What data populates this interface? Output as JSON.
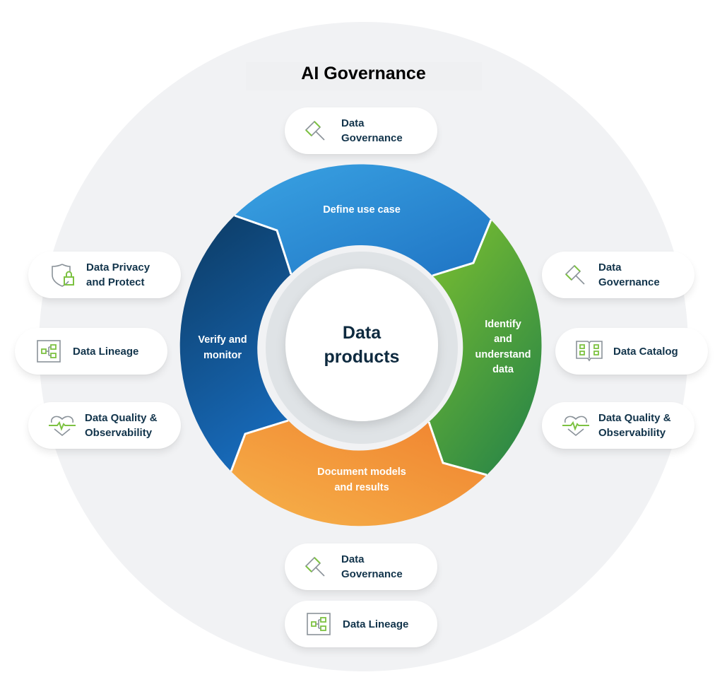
{
  "title": "AI Governance",
  "center": {
    "line1": "Data",
    "line2": "products"
  },
  "segments": [
    {
      "id": "define",
      "lines": [
        "Define use case"
      ],
      "color_start": "#3aa3e3",
      "color_end": "#1f74c4"
    },
    {
      "id": "identify",
      "lines": [
        "Identify",
        "and",
        "understand",
        "data"
      ],
      "color_start": "#7dc02f",
      "color_end": "#2f8a45"
    },
    {
      "id": "document",
      "lines": [
        "Document models",
        "and results"
      ],
      "color_start": "#f6b24a",
      "color_end": "#f0822f"
    },
    {
      "id": "verify",
      "lines": [
        "Verify and",
        "monitor"
      ],
      "color_start": "#0c3a62",
      "color_end": "#1768b6"
    }
  ],
  "cards": {
    "top_governance": {
      "label": "Data\nGovernance",
      "icon": "gavel-icon"
    },
    "left_privacy": {
      "label": "Data Privacy\nand Protect",
      "icon": "shield-lock-icon"
    },
    "left_lineage": {
      "label": "Data Lineage",
      "icon": "lineage-icon"
    },
    "left_quality": {
      "label": "Data Quality &\nObservability",
      "icon": "heart-pulse-icon"
    },
    "right_governance": {
      "label": "Data\nGovernance",
      "icon": "gavel-icon"
    },
    "right_catalog": {
      "label": "Data Catalog",
      "icon": "book-icon"
    },
    "right_quality": {
      "label": "Data Quality &\nObservability",
      "icon": "heart-pulse-icon"
    },
    "bottom_governance": {
      "label": "Data\nGovernance",
      "icon": "gavel-icon"
    },
    "bottom_lineage": {
      "label": "Data Lineage",
      "icon": "lineage-icon"
    }
  },
  "colors": {
    "accent_green": "#7dc242",
    "icon_gray": "#8a9299",
    "card_text": "#12344b",
    "outer_bg": "#f1f2f4",
    "inner_ring": "#dfe3e6"
  }
}
